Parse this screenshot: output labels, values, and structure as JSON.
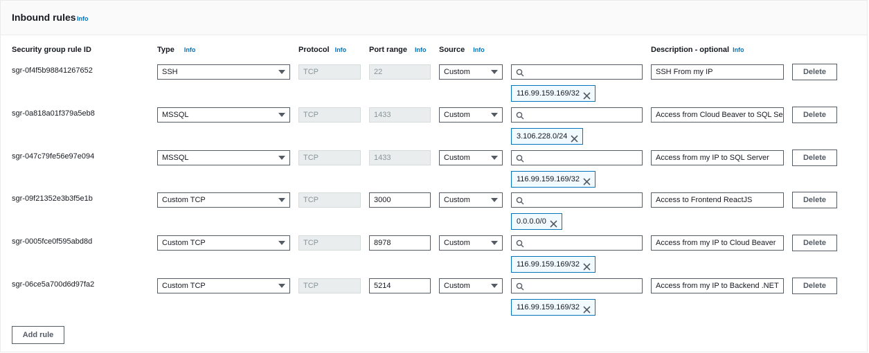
{
  "section": {
    "title": "Inbound rules",
    "info": "Info"
  },
  "columns": {
    "rule_id": "Security group rule ID",
    "type": "Type",
    "protocol": "Protocol",
    "port_range": "Port range",
    "source": "Source",
    "description": "Description - optional",
    "info": "Info"
  },
  "rows": [
    {
      "id": "sgr-0f4f5b98841267652",
      "type": "SSH",
      "protocol": "TCP",
      "port": "22",
      "port_editable": false,
      "source": "Custom",
      "cidr": "116.99.159.169/32",
      "description": "SSH From my IP",
      "delete": "Delete"
    },
    {
      "id": "sgr-0a818a01f379a5eb8",
      "type": "MSSQL",
      "protocol": "TCP",
      "port": "1433",
      "port_editable": false,
      "source": "Custom",
      "cidr": "3.106.228.0/24",
      "description": "Access from Cloud Beaver to SQL Serv",
      "delete": "Delete"
    },
    {
      "id": "sgr-047c79fe56e97e094",
      "type": "MSSQL",
      "protocol": "TCP",
      "port": "1433",
      "port_editable": false,
      "source": "Custom",
      "cidr": "116.99.159.169/32",
      "description": "Access from my IP to SQL Server",
      "delete": "Delete"
    },
    {
      "id": "sgr-09f21352e3b3f5e1b",
      "type": "Custom TCP",
      "protocol": "TCP",
      "port": "3000",
      "port_editable": true,
      "source": "Custom",
      "cidr": "0.0.0.0/0",
      "description": "Access to Frontend ReactJS",
      "delete": "Delete"
    },
    {
      "id": "sgr-0005fce0f595abd8d",
      "type": "Custom TCP",
      "protocol": "TCP",
      "port": "8978",
      "port_editable": true,
      "source": "Custom",
      "cidr": "116.99.159.169/32",
      "description": "Access from my IP to Cloud Beaver",
      "delete": "Delete"
    },
    {
      "id": "sgr-06ce5a700d6d97fa2",
      "type": "Custom TCP",
      "protocol": "TCP",
      "port": "5214",
      "port_editable": true,
      "source": "Custom",
      "cidr": "116.99.159.169/32",
      "description": "Access from my IP to Backend .NET",
      "delete": "Delete"
    }
  ],
  "add_rule_label": "Add rule",
  "icons": {
    "search": "search-icon",
    "remove": "close-icon",
    "caret": "caret-down-icon"
  },
  "colors": {
    "link": "#0073bb",
    "token_border": "#0073bb",
    "token_bg": "#f1faff"
  }
}
